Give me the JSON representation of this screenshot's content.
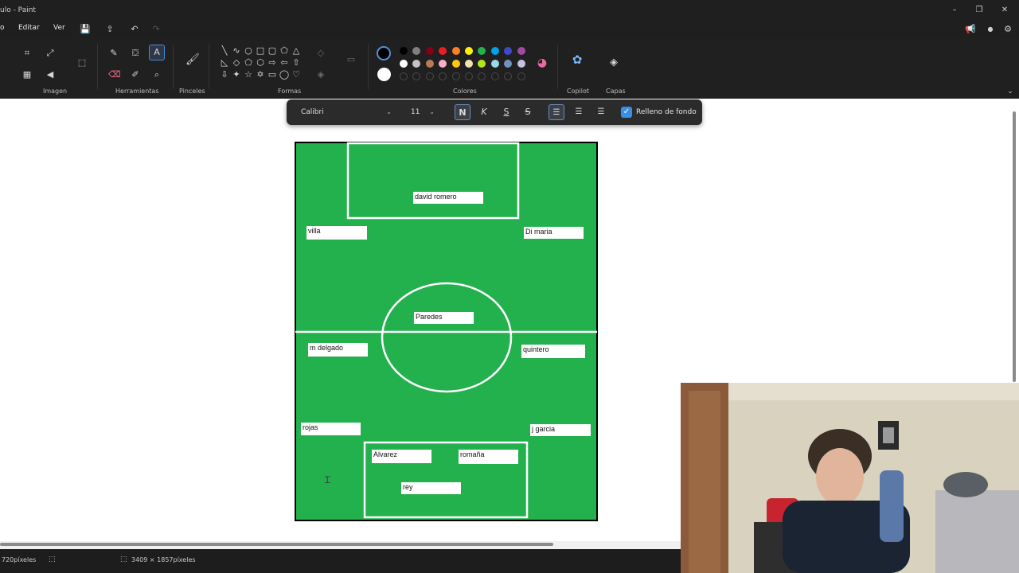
{
  "window": {
    "title": "ulo - Paint",
    "minimize_icon": "minimize-icon",
    "maximize_icon": "maximize-icon",
    "close_icon": "close-icon"
  },
  "menu": {
    "items": [
      "Editar",
      "Ver"
    ]
  },
  "ribbon": {
    "groups": {
      "imagen": "Imagen",
      "herramientas": "Herramientas",
      "pinceles": "Pinceles",
      "formas": "Formas",
      "colores": "Colores",
      "copilot": "Copilot",
      "capas": "Capas"
    },
    "active_tool": "text-tool",
    "primary_color": "#000000",
    "secondary_color": "#ffffff",
    "palette_row1": [
      "#000000",
      "#7f7f7f",
      "#880015",
      "#ed1c24",
      "#ff7f27",
      "#fff200",
      "#22b14c",
      "#00a2e8",
      "#3f48cc",
      "#a349a4"
    ],
    "palette_row2": [
      "#ffffff",
      "#c3c3c3",
      "#b97a57",
      "#ffaec9",
      "#ffc90e",
      "#efe4b0",
      "#b5e61d",
      "#99d9ea",
      "#7092be",
      "#c8bfe7"
    ]
  },
  "text_toolbar": {
    "font": "Calibri",
    "size": "11",
    "bold_label": "N",
    "italic_label": "K",
    "underline_label": "S",
    "strike_label": "S",
    "fill_checkbox_checked": true,
    "fill_label": "Relleno de fondo"
  },
  "canvas": {
    "pitch_color": "#22b14c",
    "players": [
      {
        "name": "david romero"
      },
      {
        "name": "villa"
      },
      {
        "name": "Di maria"
      },
      {
        "name": "Paredes"
      },
      {
        "name": "m delgado"
      },
      {
        "name": "quintero"
      },
      {
        "name": "rojas"
      },
      {
        "name": "j garcia"
      },
      {
        "name": "Alvarez"
      },
      {
        "name": "romaña"
      },
      {
        "name": "rey"
      }
    ]
  },
  "status": {
    "cursor_pos": "720píxeles",
    "canvas_size": "3409 × 1857píxeles"
  }
}
